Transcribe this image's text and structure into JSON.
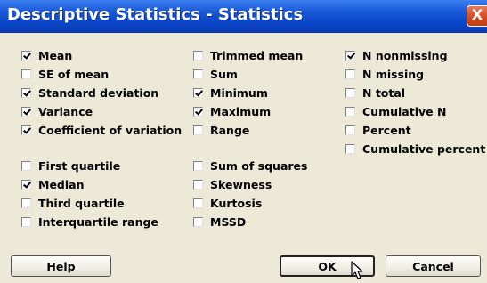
{
  "window": {
    "title": "Descriptive Statistics - Statistics",
    "close_glyph": "X"
  },
  "statistics": [
    {
      "label": "Mean",
      "checked": true
    },
    {
      "label": "SE of mean",
      "checked": false
    },
    {
      "label": "Standard deviation",
      "checked": true
    },
    {
      "label": "Variance",
      "checked": true
    },
    {
      "label": "Coefficient of variation",
      "checked": true
    },
    {
      "label": "First quartile",
      "checked": false
    },
    {
      "label": "Median",
      "checked": true
    },
    {
      "label": "Third quartile",
      "checked": false
    },
    {
      "label": "Interquartile range",
      "checked": false
    },
    {
      "label": "Trimmed mean",
      "checked": false
    },
    {
      "label": "Sum",
      "checked": false
    },
    {
      "label": "Minimum",
      "checked": true
    },
    {
      "label": "Maximum",
      "checked": true
    },
    {
      "label": "Range",
      "checked": false
    },
    {
      "label": "Sum of squares",
      "checked": false
    },
    {
      "label": "Skewness",
      "checked": false
    },
    {
      "label": "Kurtosis",
      "checked": false
    },
    {
      "label": "MSSD",
      "checked": false
    },
    {
      "label": "N nonmissing",
      "checked": true
    },
    {
      "label": "N missing",
      "checked": false
    },
    {
      "label": "N total",
      "checked": false
    },
    {
      "label": "Cumulative N",
      "checked": false
    },
    {
      "label": "Percent",
      "checked": false
    },
    {
      "label": "Cumulative percent",
      "checked": false
    }
  ],
  "buttons": {
    "help": "Help",
    "ok": "OK",
    "cancel": "Cancel"
  }
}
